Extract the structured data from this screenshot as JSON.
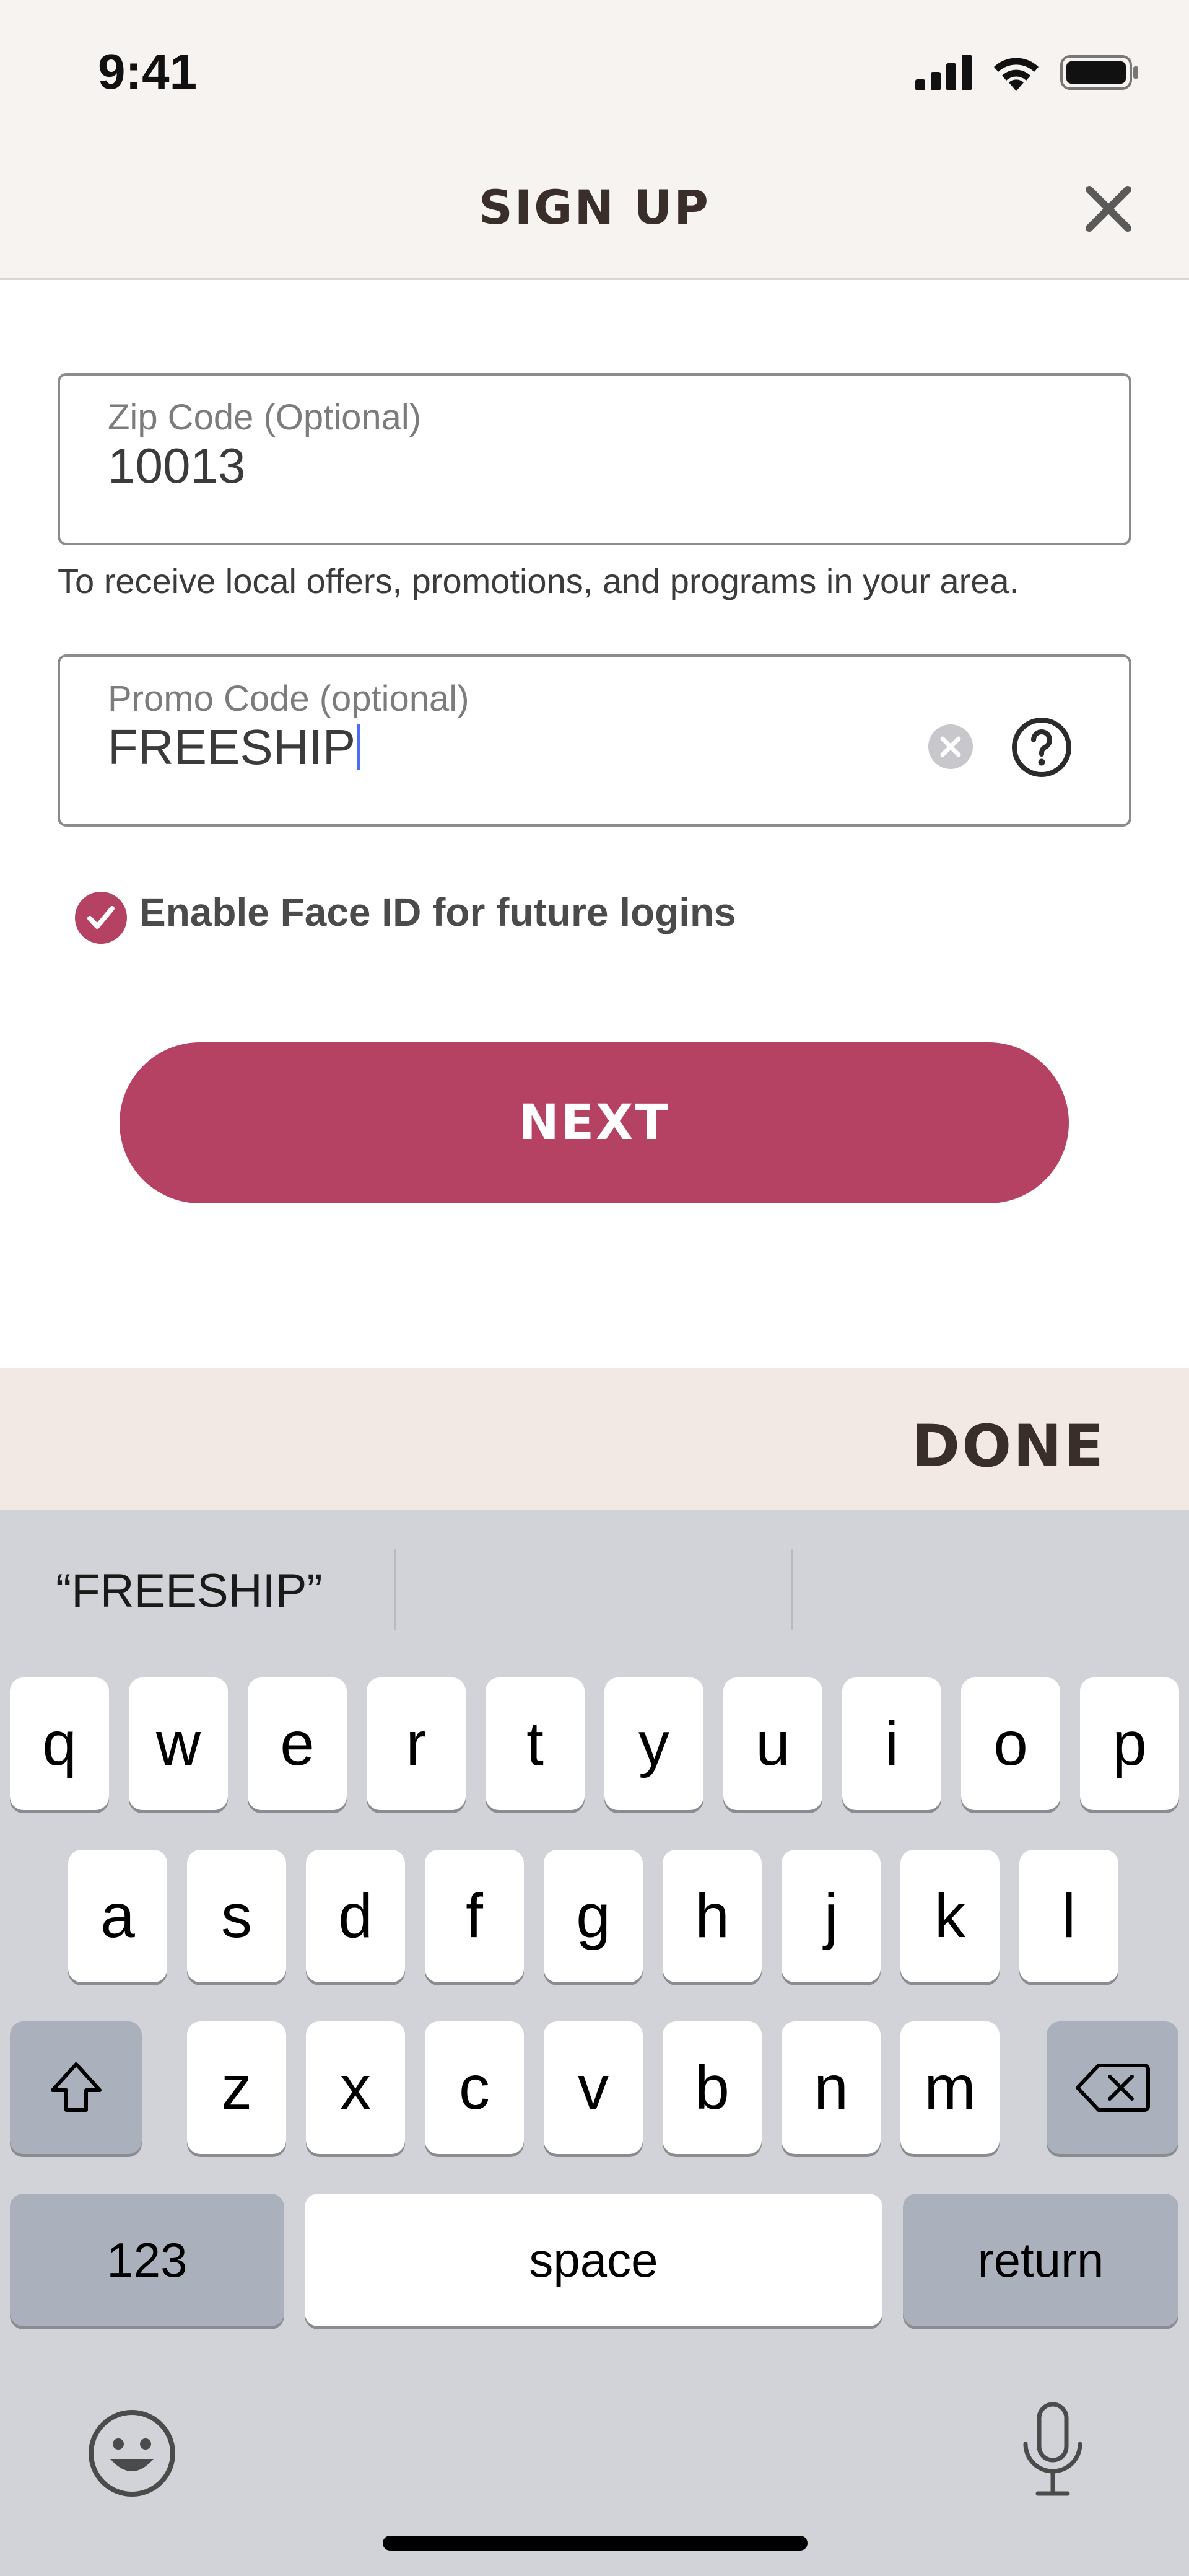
{
  "status_bar": {
    "time": "9:41"
  },
  "header": {
    "title": "SIGN UP"
  },
  "form": {
    "zip": {
      "label": "Zip Code (Optional)",
      "value": "10013"
    },
    "zip_helper": "To receive local offers, promotions, and programs in your area.",
    "promo": {
      "label": "Promo Code (optional)",
      "value": "FREESHIP"
    },
    "face_id": {
      "label": "Enable Face ID for future logins",
      "checked": true
    },
    "next_label": "NEXT"
  },
  "keyboard_toolbar": {
    "done_label": "DONE"
  },
  "keyboard": {
    "suggestion": "“FREESHIP”",
    "row1": [
      "q",
      "w",
      "e",
      "r",
      "t",
      "y",
      "u",
      "i",
      "o",
      "p"
    ],
    "row2": [
      "a",
      "s",
      "d",
      "f",
      "g",
      "h",
      "j",
      "k",
      "l"
    ],
    "row3": [
      "z",
      "x",
      "c",
      "v",
      "b",
      "n",
      "m"
    ],
    "numbers_label": "123",
    "space_label": "space",
    "return_label": "return"
  },
  "colors": {
    "accent": "#b54163",
    "header_bg": "#f6f3f0",
    "toolbar_bg": "#f2e9e5",
    "keyboard_bg": "#d1d3d9"
  }
}
